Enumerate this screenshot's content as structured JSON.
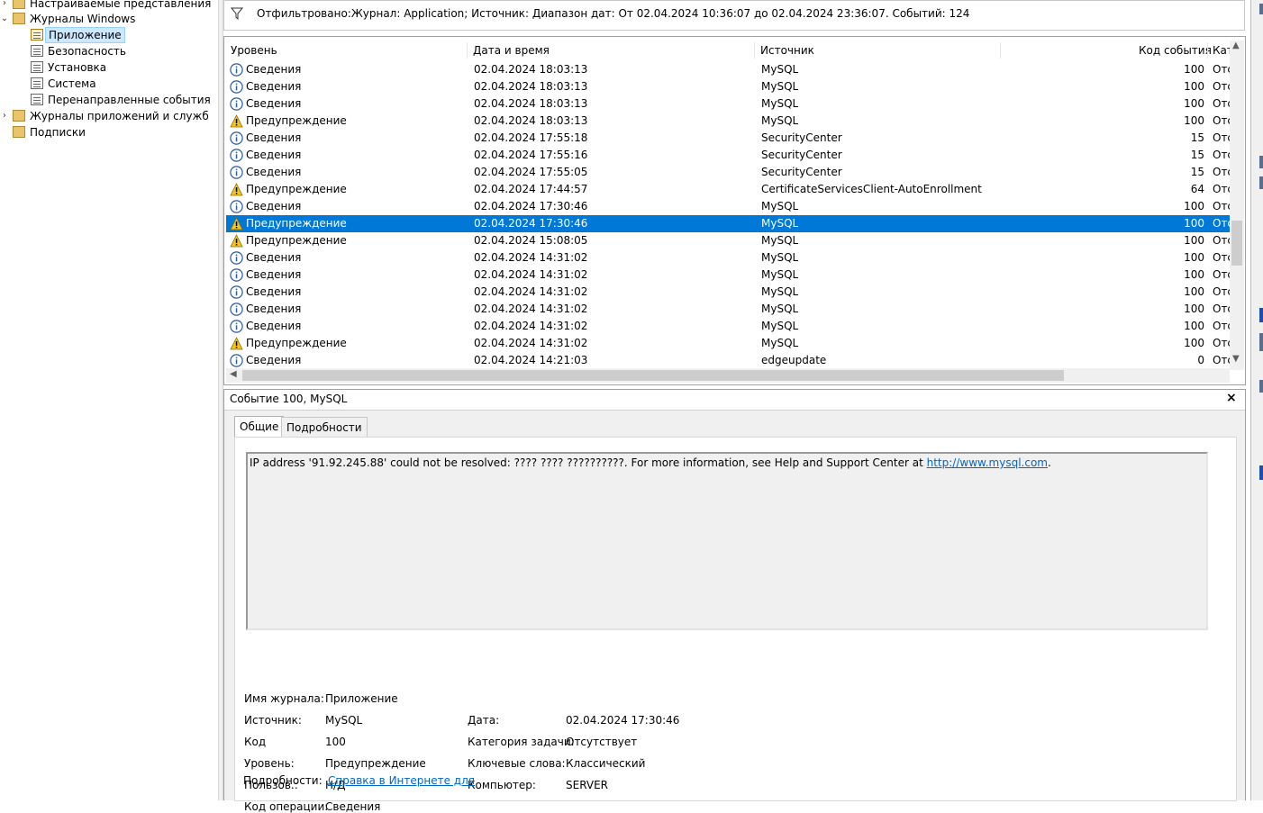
{
  "tree": {
    "items": [
      {
        "label": "Настраиваемые представления",
        "level": 0,
        "expanded": false
      },
      {
        "label": "Журналы Windows",
        "level": 0,
        "expanded": true
      },
      {
        "label": "Приложение",
        "level": 1,
        "selected": true
      },
      {
        "label": "Безопасность",
        "level": 1
      },
      {
        "label": "Установка",
        "level": 1
      },
      {
        "label": "Система",
        "level": 1
      },
      {
        "label": "Перенаправленные события",
        "level": 1
      },
      {
        "label": "Журналы приложений и служб",
        "level": 0,
        "expanded": false
      },
      {
        "label": "Подписки",
        "level": 0
      }
    ]
  },
  "filter": {
    "text": "Отфильтровано:Журнал: Application; Источник: Диапазон дат: От 02.04.2024 10:36:07 до 02.04.2024 23:36:07. Событий: 124"
  },
  "grid": {
    "columns": [
      "Уровень",
      "Дата и время",
      "Источник",
      "Код события",
      "Кат"
    ],
    "rows": [
      {
        "level": "Сведения",
        "type": "info",
        "date": "02.04.2024 18:03:13",
        "source": "MySQL",
        "code": "100",
        "cat": "Отс"
      },
      {
        "level": "Сведения",
        "type": "info",
        "date": "02.04.2024 18:03:13",
        "source": "MySQL",
        "code": "100",
        "cat": "Отс"
      },
      {
        "level": "Сведения",
        "type": "info",
        "date": "02.04.2024 18:03:13",
        "source": "MySQL",
        "code": "100",
        "cat": "Отс"
      },
      {
        "level": "Предупреждение",
        "type": "warn",
        "date": "02.04.2024 18:03:13",
        "source": "MySQL",
        "code": "100",
        "cat": "Отс"
      },
      {
        "level": "Сведения",
        "type": "info",
        "date": "02.04.2024 17:55:18",
        "source": "SecurityCenter",
        "code": "15",
        "cat": "Отс"
      },
      {
        "level": "Сведения",
        "type": "info",
        "date": "02.04.2024 17:55:16",
        "source": "SecurityCenter",
        "code": "15",
        "cat": "Отс"
      },
      {
        "level": "Сведения",
        "type": "info",
        "date": "02.04.2024 17:55:05",
        "source": "SecurityCenter",
        "code": "15",
        "cat": "Отс"
      },
      {
        "level": "Предупреждение",
        "type": "warn",
        "date": "02.04.2024 17:44:57",
        "source": "CertificateServicesClient-AutoEnrollment",
        "code": "64",
        "cat": "Отс"
      },
      {
        "level": "Сведения",
        "type": "info",
        "date": "02.04.2024 17:30:46",
        "source": "MySQL",
        "code": "100",
        "cat": "Отс"
      },
      {
        "level": "Предупреждение",
        "type": "warn",
        "date": "02.04.2024 17:30:46",
        "source": "MySQL",
        "code": "100",
        "cat": "Отс",
        "selected": true
      },
      {
        "level": "Предупреждение",
        "type": "warn",
        "date": "02.04.2024 15:08:05",
        "source": "MySQL",
        "code": "100",
        "cat": "Отс"
      },
      {
        "level": "Сведения",
        "type": "info",
        "date": "02.04.2024 14:31:02",
        "source": "MySQL",
        "code": "100",
        "cat": "Отс"
      },
      {
        "level": "Сведения",
        "type": "info",
        "date": "02.04.2024 14:31:02",
        "source": "MySQL",
        "code": "100",
        "cat": "Отс"
      },
      {
        "level": "Сведения",
        "type": "info",
        "date": "02.04.2024 14:31:02",
        "source": "MySQL",
        "code": "100",
        "cat": "Отс"
      },
      {
        "level": "Сведения",
        "type": "info",
        "date": "02.04.2024 14:31:02",
        "source": "MySQL",
        "code": "100",
        "cat": "Отс"
      },
      {
        "level": "Сведения",
        "type": "info",
        "date": "02.04.2024 14:31:02",
        "source": "MySQL",
        "code": "100",
        "cat": "Отс"
      },
      {
        "level": "Предупреждение",
        "type": "warn",
        "date": "02.04.2024 14:31:02",
        "source": "MySQL",
        "code": "100",
        "cat": "Отс"
      },
      {
        "level": "Сведения",
        "type": "info",
        "date": "02.04.2024 14:21:03",
        "source": "edgeupdate",
        "code": "0",
        "cat": "Отс"
      }
    ]
  },
  "detail": {
    "title": "Событие 100, MySQL",
    "close_glyph": "×",
    "tabs": [
      "Общие",
      "Подробности"
    ],
    "message_prefix": "IP address '91.92.245.88' could not be resolved: ???? ???? ??????????. For more information, see Help and Support Center at ",
    "message_link": "http://www.mysql.com",
    "message_suffix": ".",
    "props": {
      "log_name_label": "Имя журнала:",
      "log_name": "Приложение",
      "source_label": "Источник:",
      "source": "MySQL",
      "date_label": "Дата:",
      "date": "02.04.2024 17:30:46",
      "code_label": "Код",
      "code": "100",
      "task_label": "Категория задачи:",
      "task": "Отсутствует",
      "level_label": "Уровень:",
      "level": "Предупреждение",
      "keywords_label": "Ключевые слова:",
      "keywords": "Классический",
      "user_label": "Пользов.:",
      "user": "Н/Д",
      "computer_label": "Компьютер:",
      "computer": "SERVER",
      "opcode_label": "Код операции:",
      "opcode": "Сведения",
      "more_label": "Подробности:",
      "more_link": "Справка в Интернете для "
    }
  },
  "colors": {
    "selection": "#0078d7",
    "info_icon": "#2a5aa0",
    "warn_icon": "#f5c518",
    "link": "#0066cc"
  }
}
